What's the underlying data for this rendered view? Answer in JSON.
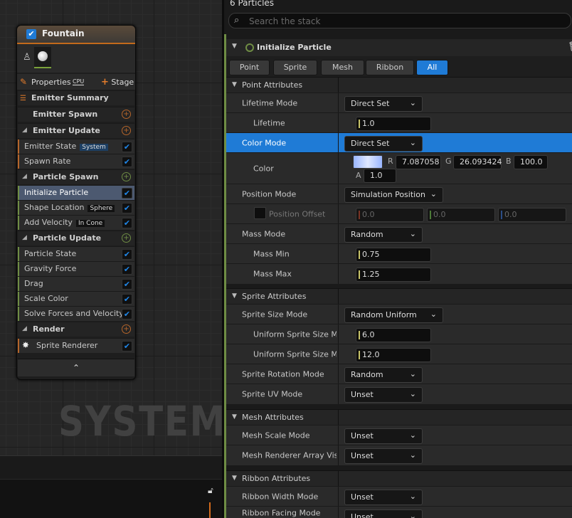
{
  "graph": {
    "watermark": "SYSTEM"
  },
  "node": {
    "title": "Fountain",
    "properties_label": "Properties",
    "cpu_label": "CPU",
    "stage_label": "Stage",
    "rows": {
      "emitter_summary": "Emitter Summary",
      "emitter_spawn": "Emitter Spawn",
      "emitter_update": "Emitter Update",
      "emitter_state": "Emitter State",
      "emitter_state_tag": "System",
      "spawn_rate": "Spawn Rate",
      "particle_spawn": "Particle Spawn",
      "initialize_particle": "Initialize Particle",
      "shape_location": "Shape Location",
      "shape_location_tag": "Sphere",
      "add_velocity": "Add Velocity",
      "add_velocity_tag": "In Cone",
      "particle_update": "Particle Update",
      "particle_state": "Particle State",
      "gravity_force": "Gravity Force",
      "drag": "Drag",
      "scale_color": "Scale Color",
      "solve_forces": "Solve Forces and Velocity",
      "render": "Render",
      "sprite_renderer": "Sprite Renderer"
    }
  },
  "panel": {
    "particles_count": "6 Particles",
    "search_placeholder": "Search the stack",
    "module_title": "Initialize Particle",
    "filters": [
      "Point",
      "Sprite",
      "Mesh",
      "Ribbon",
      "All"
    ],
    "active_filter": "All",
    "sections": {
      "point": "Point Attributes",
      "sprite": "Sprite Attributes",
      "mesh": "Mesh Attributes",
      "ribbon": "Ribbon Attributes"
    },
    "props": {
      "lifetime_mode": {
        "label": "Lifetime Mode",
        "value": "Direct Set"
      },
      "lifetime": {
        "label": "Lifetime",
        "value": "1.0"
      },
      "color_mode": {
        "label": "Color Mode",
        "value": "Direct Set"
      },
      "color": {
        "label": "Color",
        "r_label": "R",
        "r": "7.087058",
        "g_label": "G",
        "g": "26.093424",
        "b_label": "B",
        "b": "100.0",
        "a_label": "A",
        "a": "1.0"
      },
      "position_mode": {
        "label": "Position Mode",
        "value": "Simulation Position"
      },
      "position_offset": {
        "label": "Position Offset",
        "x": "0.0",
        "y": "0.0",
        "z": "0.0"
      },
      "mass_mode": {
        "label": "Mass Mode",
        "value": "Random"
      },
      "mass_min": {
        "label": "Mass Min",
        "value": "0.75"
      },
      "mass_max": {
        "label": "Mass Max",
        "value": "1.25"
      },
      "sprite_size_mode": {
        "label": "Sprite Size Mode",
        "value": "Random Uniform"
      },
      "uniform_min": {
        "label": "Uniform Sprite Size Mi",
        "value": "6.0"
      },
      "uniform_max": {
        "label": "Uniform Sprite Size Ma",
        "value": "12.0"
      },
      "sprite_rotation_mode": {
        "label": "Sprite Rotation Mode",
        "value": "Random"
      },
      "sprite_uv_mode": {
        "label": "Sprite UV Mode",
        "value": "Unset"
      },
      "mesh_scale_mode": {
        "label": "Mesh Scale Mode",
        "value": "Unset"
      },
      "mesh_renderer_array": {
        "label": "Mesh Renderer Array Visil",
        "value": "Unset"
      },
      "ribbon_width_mode": {
        "label": "Ribbon Width Mode",
        "value": "Unset"
      },
      "ribbon_facing_mode": {
        "label": "Ribbon Facing Mode",
        "value": "Unset"
      }
    }
  },
  "colors": {
    "accent": "#1f7bd6",
    "emitter_orange": "#c36a1b",
    "module_green": "#6f8d44"
  }
}
